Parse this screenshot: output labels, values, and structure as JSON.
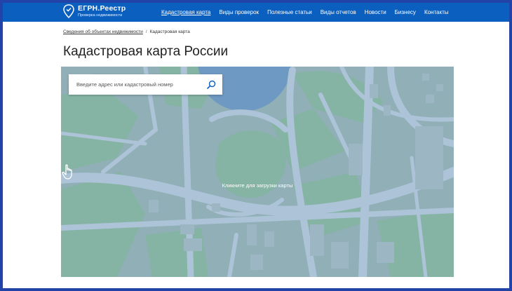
{
  "header": {
    "logo_title": "ЕГРН.Реестр",
    "logo_subtitle": "Проверка недвижимости",
    "nav": [
      {
        "label": "Кадастровая карта",
        "active": true
      },
      {
        "label": "Виды проверок"
      },
      {
        "label": "Полезные статьи"
      },
      {
        "label": "Виды отчетов"
      },
      {
        "label": "Новости"
      },
      {
        "label": "Бизнесу"
      },
      {
        "label": "Контакты"
      }
    ]
  },
  "breadcrumb": {
    "link": "Сведения об объектах недвижимости",
    "separator": "/",
    "current": "Кадастровая карта"
  },
  "page_title": "Кадастровая карта России",
  "map": {
    "search_placeholder": "Введите адрес или кадастровый номер",
    "hint": "Кликните для загрузки карты",
    "icons": {
      "search": "search-icon",
      "hint": "hand-pointer-icon"
    }
  },
  "colors": {
    "header_bg": "#0b5fbf",
    "map_land": "#86a8ae",
    "map_green": "#7aae9a",
    "map_water": "#5f8fbc",
    "map_road": "#a9c0d6"
  }
}
